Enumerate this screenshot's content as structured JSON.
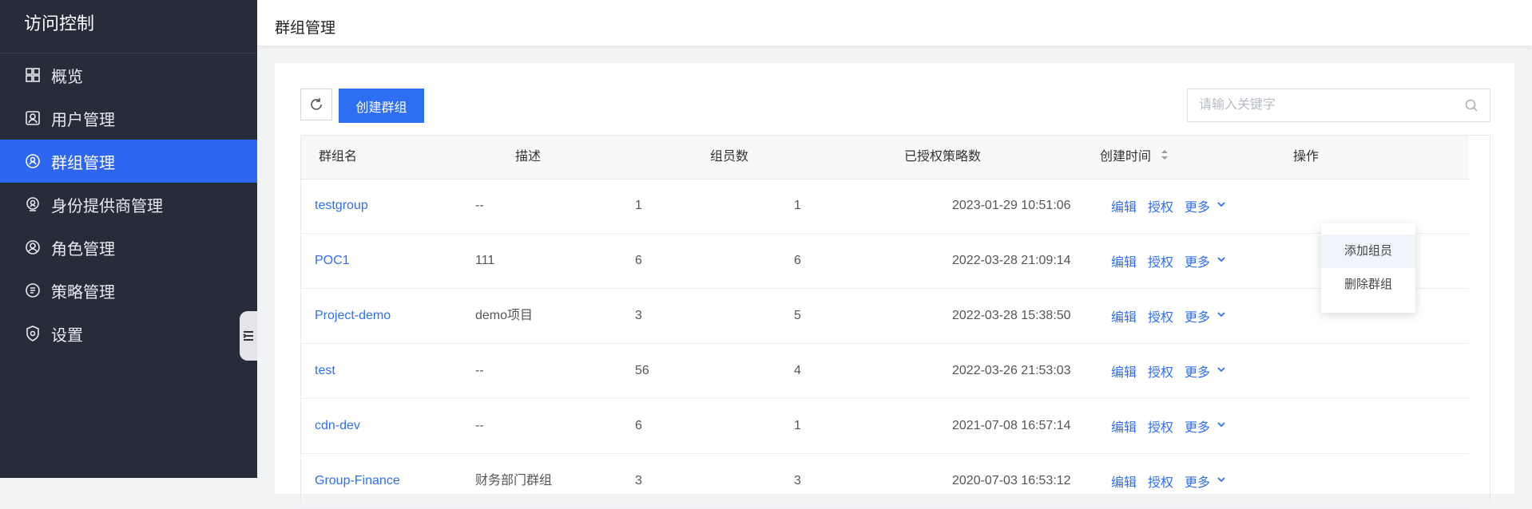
{
  "sidebar": {
    "title": "访问控制",
    "items": [
      {
        "label": "概览",
        "icon": "grid-icon"
      },
      {
        "label": "用户管理",
        "icon": "user-card-icon"
      },
      {
        "label": "群组管理",
        "icon": "group-icon",
        "active": true
      },
      {
        "label": "身份提供商管理",
        "icon": "identity-provider-icon"
      },
      {
        "label": "角色管理",
        "icon": "role-icon"
      },
      {
        "label": "策略管理",
        "icon": "policy-icon"
      },
      {
        "label": "设置",
        "icon": "shield-settings-icon"
      }
    ]
  },
  "header": {
    "title": "群组管理"
  },
  "toolbar": {
    "create_label": "创建群组",
    "search_placeholder": "请输入关键字"
  },
  "table": {
    "columns": [
      "群组名",
      "描述",
      "组员数",
      "已授权策略数",
      "创建时间",
      "操作"
    ],
    "rows": [
      {
        "name": "testgroup",
        "desc": "--",
        "members": "1",
        "policies": "1",
        "created": "2023-01-29 10:51:06"
      },
      {
        "name": "POC1",
        "desc": "111",
        "members": "6",
        "policies": "6",
        "created": "2022-03-28 21:09:14"
      },
      {
        "name": "Project-demo",
        "desc": "demo项目",
        "members": "3",
        "policies": "5",
        "created": "2022-03-28 15:38:50"
      },
      {
        "name": "test",
        "desc": "--",
        "members": "56",
        "policies": "4",
        "created": "2022-03-26 21:53:03"
      },
      {
        "name": "cdn-dev",
        "desc": "--",
        "members": "6",
        "policies": "1",
        "created": "2021-07-08 16:57:14"
      },
      {
        "name": "Group-Finance",
        "desc": "财务部门群组",
        "members": "3",
        "policies": "3",
        "created": "2020-07-03 16:53:12"
      }
    ],
    "actions": {
      "edit": "编辑",
      "authorize": "授权",
      "more": "更多"
    }
  },
  "dropdown": {
    "items": [
      "添加组员",
      "删除群组"
    ]
  },
  "colors": {
    "sidebar_bg": "#272c3b",
    "accent": "#2e6ff2",
    "active_item": "#2d66f0"
  }
}
